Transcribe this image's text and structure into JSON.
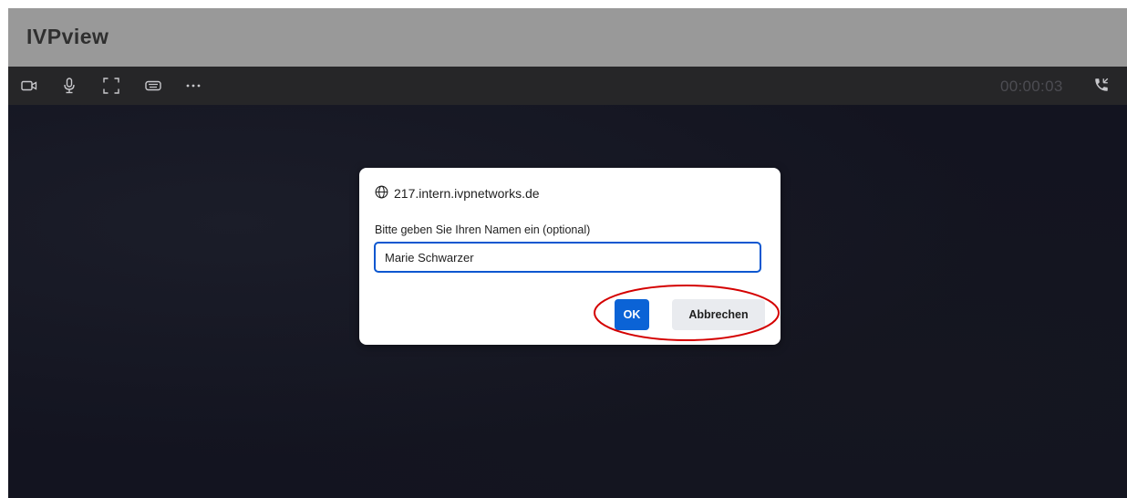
{
  "app": {
    "title": "IVPview"
  },
  "toolbar": {
    "icons": [
      "camera-icon",
      "microphone-icon",
      "fullscreen-icon",
      "keyboard-icon",
      "more-icon"
    ],
    "timer": "00:00:03",
    "end_call_icon": "phone-icon"
  },
  "dialog": {
    "origin": "217.intern.ivpnetworks.de",
    "origin_icon": "globe-icon",
    "message": "Bitte geben Sie Ihren Namen ein (optional)",
    "input_value": "Marie Schwarzer",
    "ok_label": "OK",
    "cancel_label": "Abbrechen"
  },
  "colors": {
    "header_bg": "#999999",
    "toolbar_bg": "#262628",
    "video_bg": "#131420",
    "accent_blue": "#0b63d6",
    "highlight_red": "#d40000"
  }
}
